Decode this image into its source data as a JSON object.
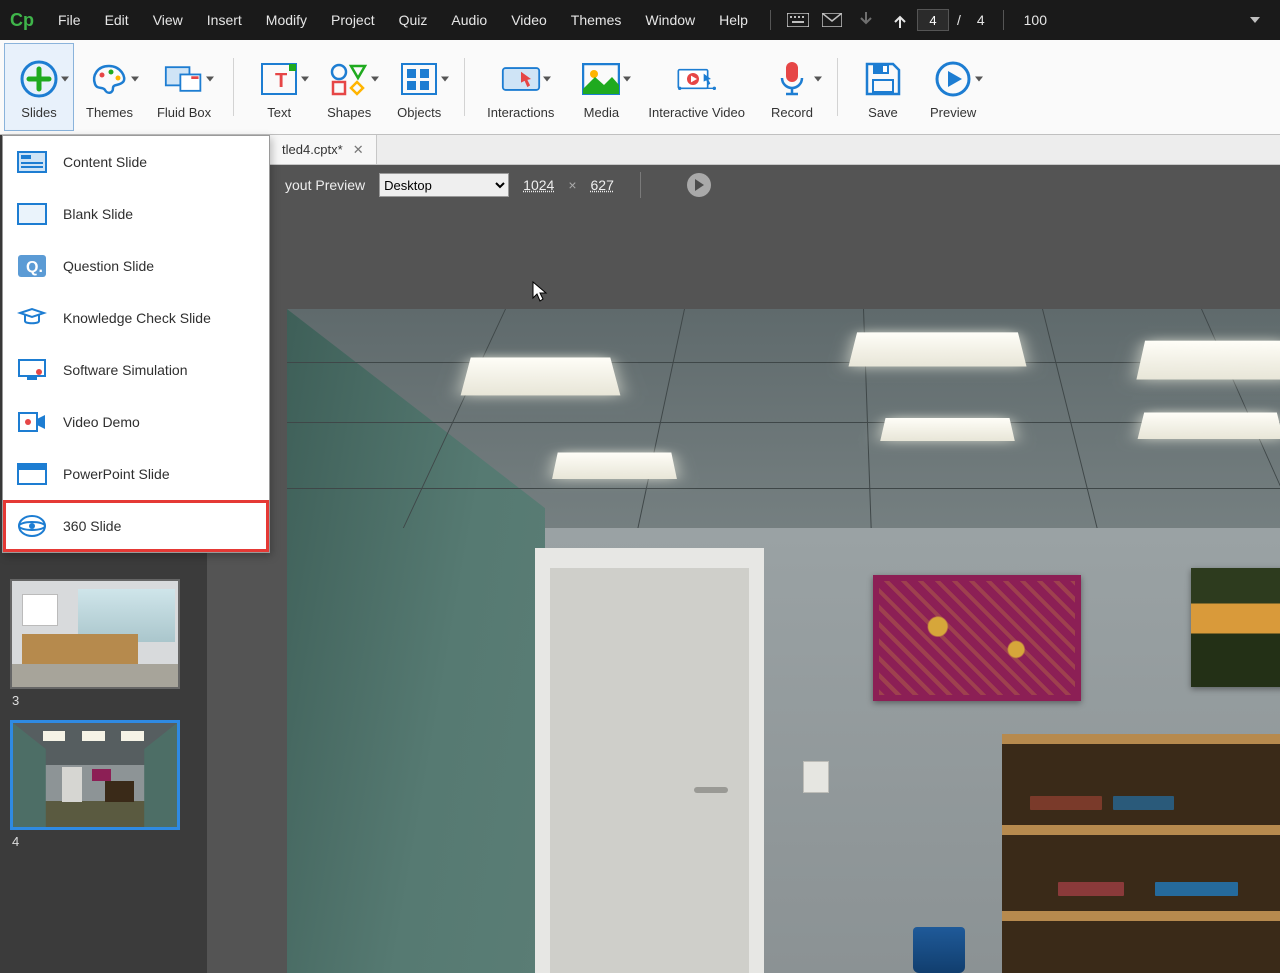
{
  "menubar": {
    "items": [
      "File",
      "Edit",
      "View",
      "Insert",
      "Modify",
      "Project",
      "Quiz",
      "Audio",
      "Video",
      "Themes",
      "Window",
      "Help"
    ],
    "page_current": "4",
    "page_sep": "/",
    "page_total": "4",
    "zoom": "100"
  },
  "ribbon": {
    "slides": "Slides",
    "themes": "Themes",
    "fluidbox": "Fluid Box",
    "text": "Text",
    "shapes": "Shapes",
    "objects": "Objects",
    "interactions": "Interactions",
    "media": "Media",
    "interactive_video": "Interactive Video",
    "record": "Record",
    "save": "Save",
    "preview": "Preview"
  },
  "tab": {
    "title": "tled4.cptx*"
  },
  "previewbar": {
    "label": "yout Preview",
    "device": "Desktop",
    "width": "1024",
    "height": "627"
  },
  "slides_menu": {
    "items": [
      {
        "label": "Content Slide",
        "icon": "content"
      },
      {
        "label": "Blank Slide",
        "icon": "blank"
      },
      {
        "label": "Question Slide",
        "icon": "question"
      },
      {
        "label": "Knowledge Check Slide",
        "icon": "kc"
      },
      {
        "label": "Software Simulation",
        "icon": "sim"
      },
      {
        "label": "Video Demo",
        "icon": "vdemo"
      },
      {
        "label": "PowerPoint Slide",
        "icon": "ppt"
      },
      {
        "label": "360 Slide",
        "icon": "vr360"
      }
    ]
  },
  "thumbs": {
    "items": [
      {
        "num": "3",
        "selected": false
      },
      {
        "num": "4",
        "selected": true
      }
    ]
  }
}
